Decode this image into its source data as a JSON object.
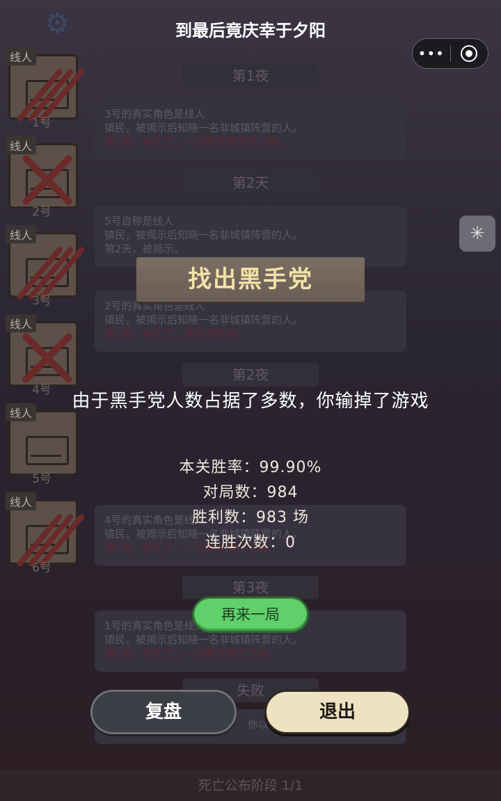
{
  "window": {
    "title": "到最后竟庆幸于夕阳"
  },
  "players": [
    {
      "role": "线人",
      "number": "1号",
      "mark": "slash"
    },
    {
      "role": "线人",
      "number": "2号",
      "mark": "x"
    },
    {
      "role": "线人",
      "number": "3号",
      "mark": "slash"
    },
    {
      "role": "线人",
      "number": "4号",
      "mark": "x"
    },
    {
      "role": "线人",
      "number": "5号",
      "mark": "none"
    },
    {
      "role": "线人",
      "number": "6号",
      "mark": "slash"
    }
  ],
  "log": {
    "titles": [
      "第1夜",
      "第2天",
      "第2夜",
      "第3夜",
      "失败"
    ],
    "entries": [
      {
        "line1": "3号的真实角色是线人",
        "line2": "镇民，被揭示后知晓一名非城镇阵营的人。",
        "line3": "第1夜，他死了，一切黑手党都在了解。"
      },
      {
        "line1": "5号自称是线人",
        "line2": "镇民，被揭示后知晓一名非城镇阵营的人。",
        "line3": "第2天，被揭示。"
      },
      {
        "line1": "2号的真实角色是线人",
        "line2": "镇民，被揭示后知晓一名非城镇阵营的人。",
        "line3": "第2夜，他死了，黑手党胜利。"
      },
      {
        "line1": "4号的真实角色是线人",
        "line2": "镇民，被揭示后知晓一名非城镇阵营的人。",
        "line3": "第3夜，他死了，一切黑手党在了解。"
      },
      {
        "line1": "1号的真实角色是线人",
        "line2": "镇民，被揭示后知晓一名非城镇阵营的人。",
        "line3": "第3夜，他死了，一切黑手党在了解。"
      }
    ],
    "footer_hint": "你以"
  },
  "phase_bar": "死亡公布阶段 1/1",
  "modal": {
    "banner": "找出黑手党",
    "message": "由于黑手党人数占据了多数，你输掉了游戏",
    "stats": {
      "win_rate": "本关胜率：99.90%",
      "games": "对局数：984",
      "wins": "胜利数：983 场",
      "streak": "连胜次数：0"
    },
    "play_again": "再来一局",
    "review": "复盘",
    "exit": "退出"
  },
  "icons": {
    "settings": "gear-icon",
    "more": "more-dots-icon",
    "close_app": "target-icon",
    "tool": "sparkle-icon"
  },
  "colors": {
    "play_again_bg": "#5fd06a",
    "exit_bg": "#efe2c2",
    "banner_text": "#f2e2a8"
  }
}
